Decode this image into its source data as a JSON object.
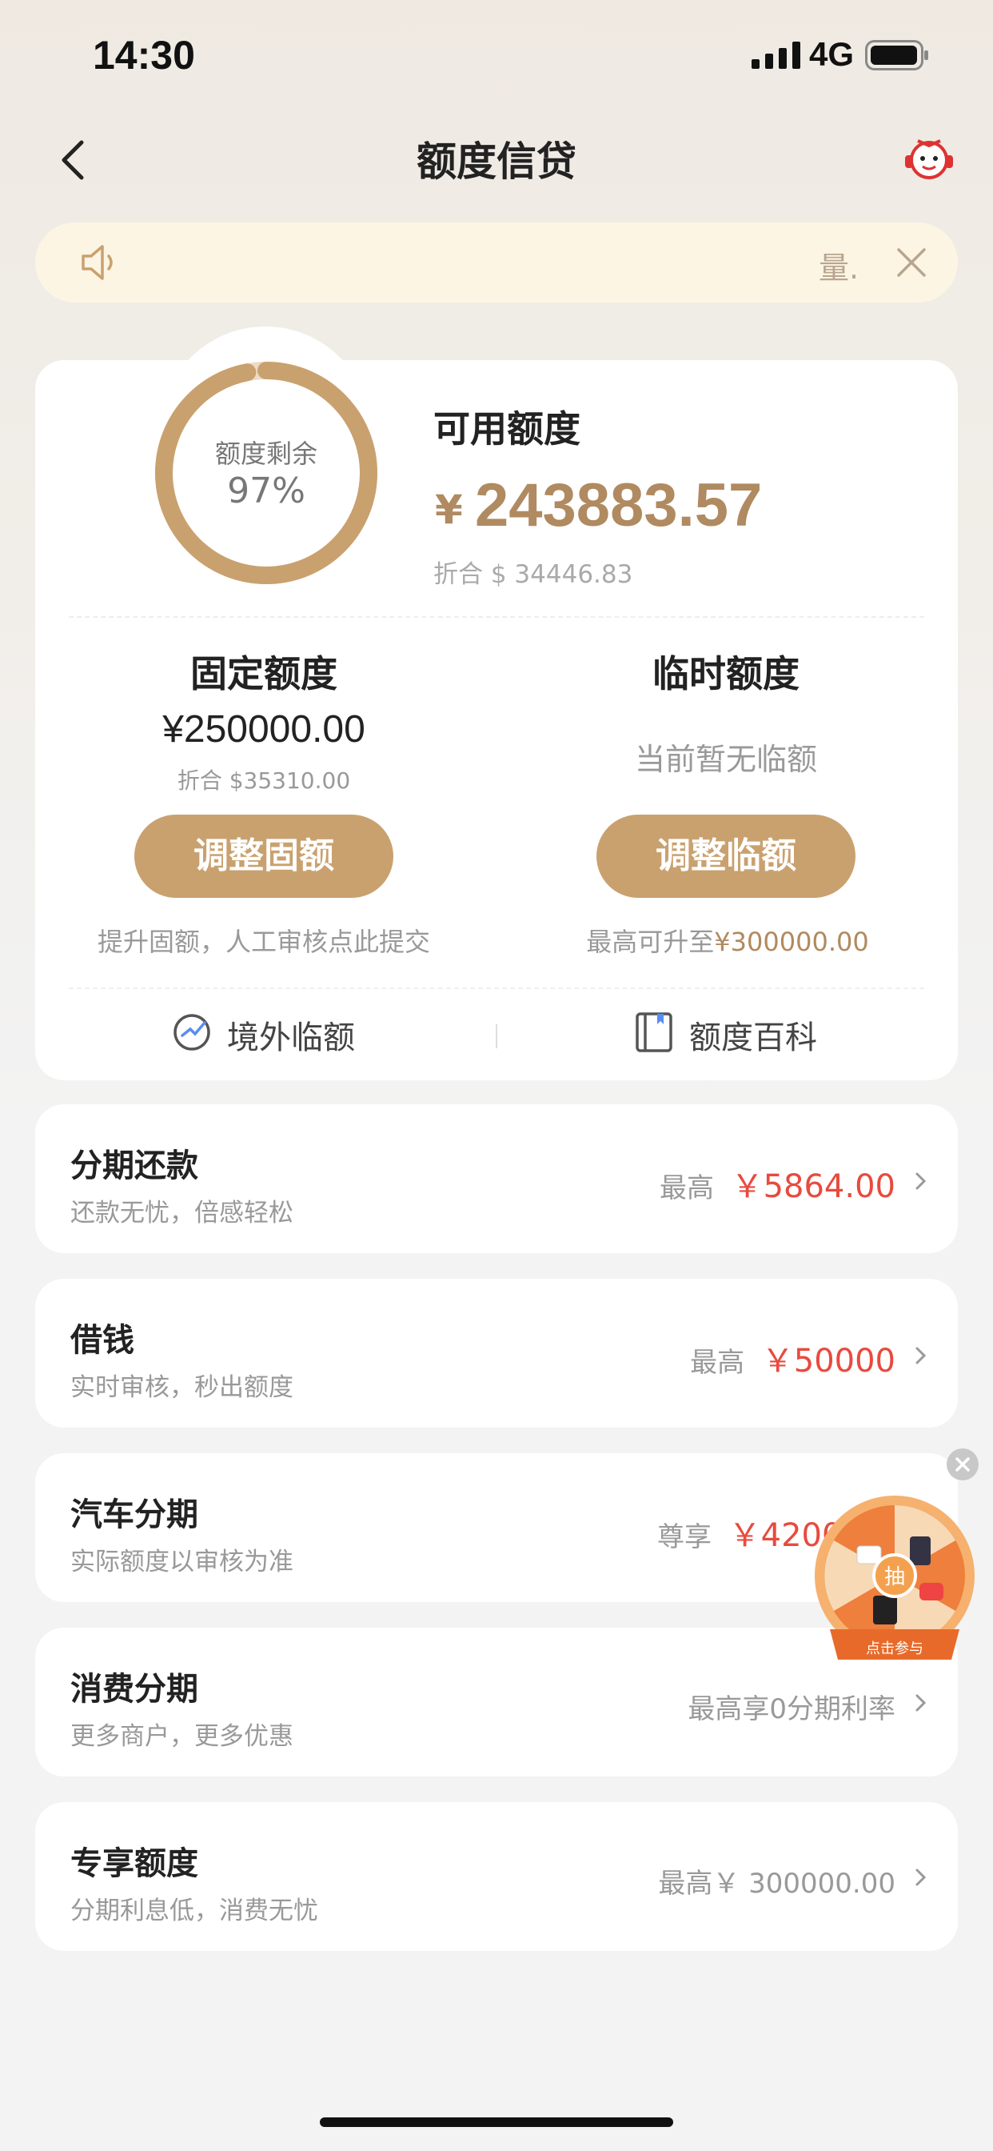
{
  "status_bar": {
    "time": "14:30",
    "network": "4G"
  },
  "nav": {
    "title": "额度信贷"
  },
  "notice": {
    "marquee_text": "量..."
  },
  "ring": {
    "label": "额度剩余",
    "percent": "97%",
    "remaining_fraction": 0.97
  },
  "available": {
    "label": "可用额度",
    "currency": "¥",
    "amount": "243883.57",
    "usd": "折合 $ 34446.83"
  },
  "fixed": {
    "title": "固定额度",
    "amount": "¥250000.00",
    "usd": "折合 $35310.00",
    "button": "调整固额",
    "hint": "提升固额，人工审核点此提交"
  },
  "temporary": {
    "title": "临时额度",
    "status": "当前暂无临额",
    "button": "调整临额",
    "hint_prefix": "最高可升至",
    "hint_amount": "¥300000.00"
  },
  "quick_links": {
    "overseas": "境外临额",
    "encyclopedia": "额度百科"
  },
  "list": [
    {
      "title": "分期还款",
      "subtitle": "还款无忧，倍感轻松",
      "prefix": "最高",
      "amount": "￥5864.00"
    },
    {
      "title": "借钱",
      "subtitle": "实时审核，秒出额度",
      "prefix": "最高",
      "amount": "￥50000"
    },
    {
      "title": "汽车分期",
      "subtitle": "实际额度以审核为准",
      "prefix": "尊享",
      "amount": "￥42000"
    },
    {
      "title": "消费分期",
      "subtitle": "更多商户，更多优惠",
      "prefix": "最高享0分期利率",
      "amount": ""
    },
    {
      "title": "专享额度",
      "subtitle": "分期利息低，消费无忧",
      "prefix": "最高￥ 300000.00",
      "amount": ""
    }
  ],
  "lottery": {
    "center": "抽",
    "banner": "点击参与"
  },
  "colors": {
    "gold": "#c9a16f",
    "gold_text": "#b08a60",
    "red": "#e84a3e",
    "orange": "#f08a45"
  }
}
